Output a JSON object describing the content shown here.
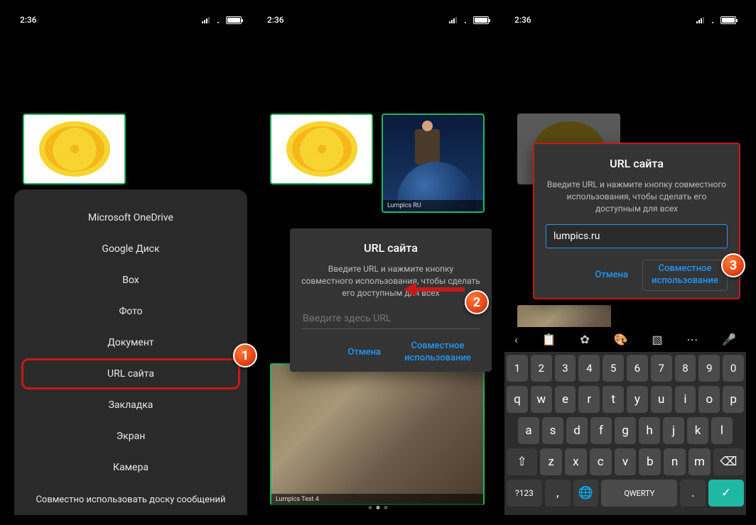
{
  "status": {
    "time": "2:36"
  },
  "tiles": {
    "earth_label": "Lumpics RU",
    "photo_label": "Lumpics Test 4"
  },
  "menu": {
    "items": [
      "Microsoft OneDrive",
      "Google Диск",
      "Box",
      "Фото",
      "Документ",
      "URL сайта",
      "Закладка",
      "Экран",
      "Камера"
    ],
    "footer": "Совместно использовать доску сообщений"
  },
  "dialog": {
    "title": "URL сайта",
    "subtitle": "Введите URL и нажмите кнопку совместного использования, чтобы сделать его доступным для всех",
    "placeholder": "Введите здесь URL",
    "value": "lumpics.ru",
    "cancel": "Отмена",
    "share": "Совместное использование"
  },
  "keyboard": {
    "row_num": [
      "1",
      "2",
      "3",
      "4",
      "5",
      "6",
      "7",
      "8",
      "9",
      "0"
    ],
    "row1": [
      "q",
      "w",
      "e",
      "r",
      "t",
      "y",
      "u",
      "i",
      "o",
      "p"
    ],
    "row2": [
      "a",
      "s",
      "d",
      "f",
      "g",
      "h",
      "j",
      "k",
      "l"
    ],
    "row3_shift": "⇧",
    "row3": [
      "z",
      "x",
      "c",
      "v",
      "b",
      "n",
      "m"
    ],
    "row3_del": "⌫",
    "bottom": {
      "sym": "?123",
      "comma": ",",
      "globe": "🌐",
      "space": "QWERTY",
      "dot": ".",
      "enter": "✓"
    }
  },
  "badges": {
    "b1": "1",
    "b2": "2",
    "b3": "3"
  }
}
